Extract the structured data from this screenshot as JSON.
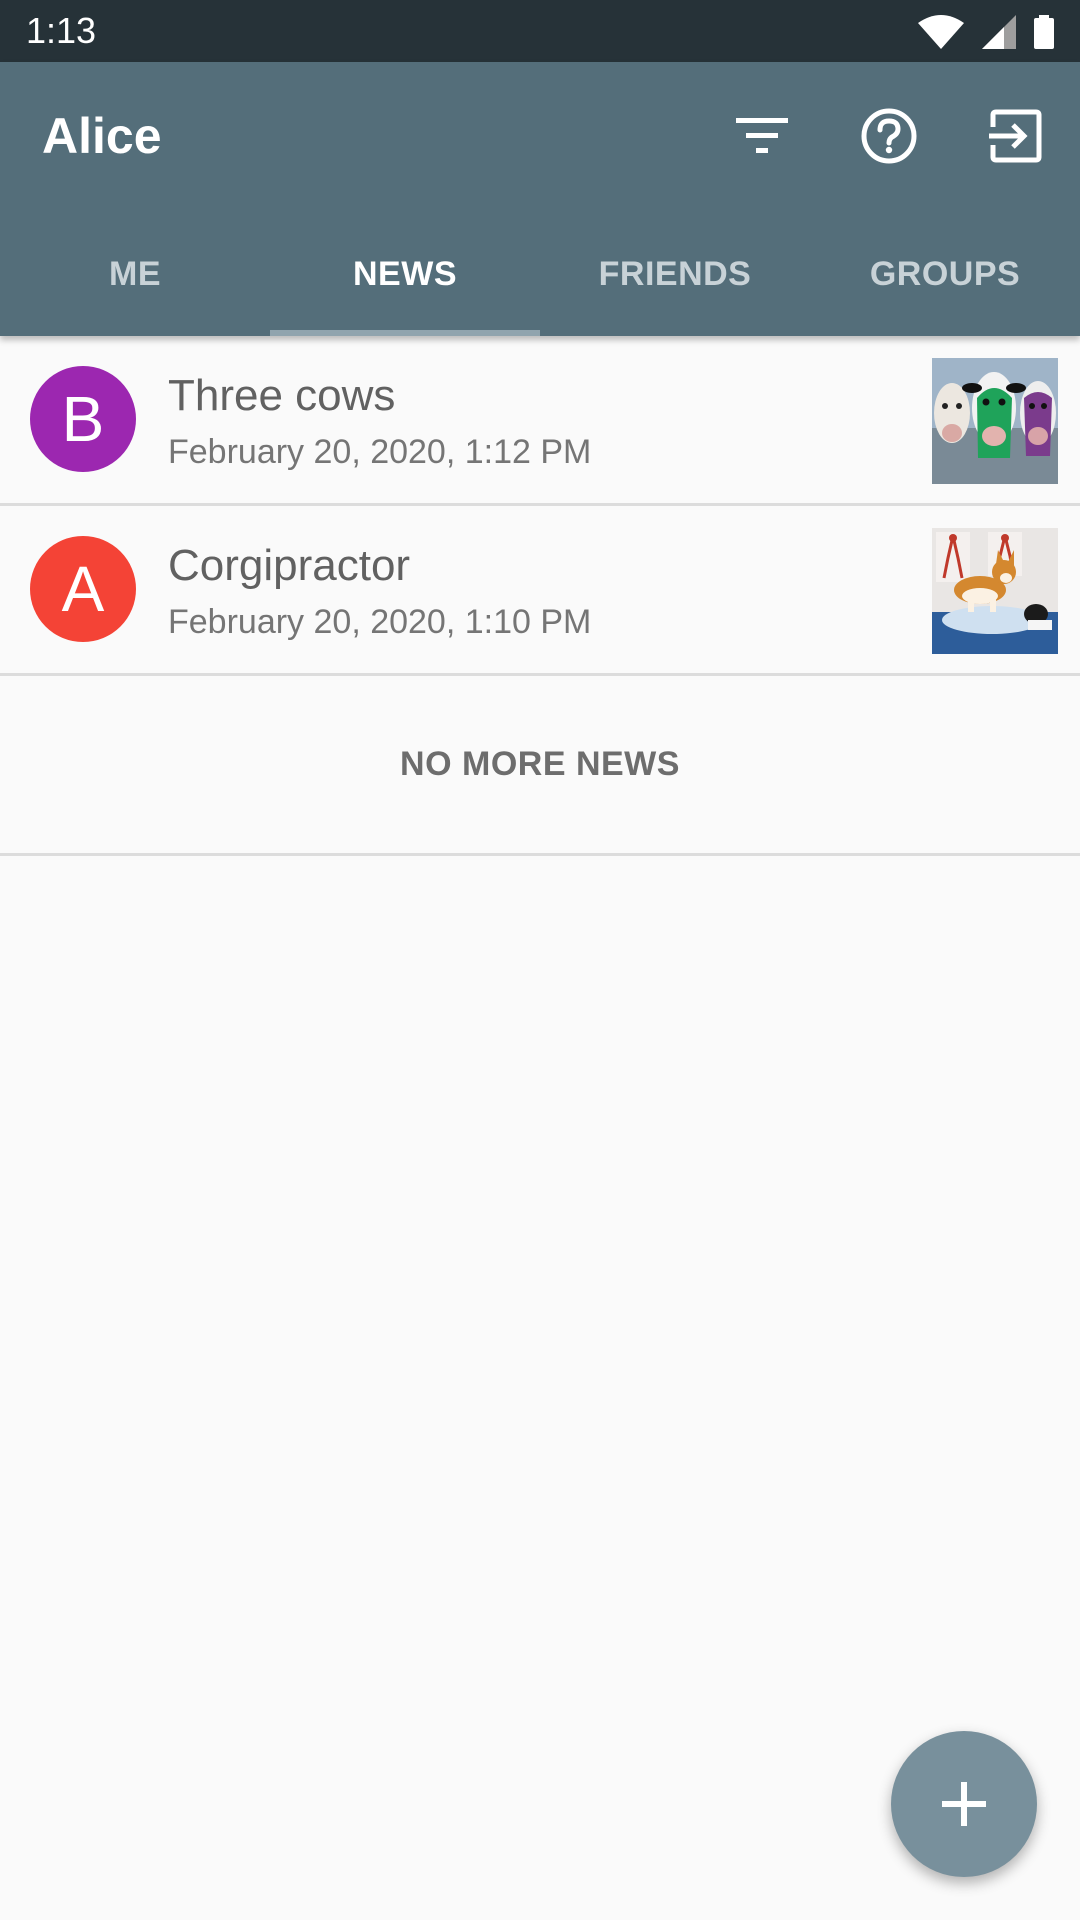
{
  "status_bar": {
    "time": "1:13",
    "icons": [
      "wifi-icon",
      "cell-signal-icon",
      "battery-icon"
    ]
  },
  "app_bar": {
    "title": "Alice",
    "actions": [
      {
        "name": "filter-icon",
        "label": "Filter"
      },
      {
        "name": "help-icon",
        "label": "Help"
      },
      {
        "name": "logout-icon",
        "label": "Log out"
      }
    ],
    "background_color": "#546e7a"
  },
  "tabs": [
    {
      "label": "ME",
      "active": false
    },
    {
      "label": "NEWS",
      "active": true
    },
    {
      "label": "FRIENDS",
      "active": false
    },
    {
      "label": "GROUPS",
      "active": false
    }
  ],
  "news": [
    {
      "avatar_letter": "B",
      "avatar_color": "#9c27b0",
      "title": "Three cows",
      "date": "February 20, 2020, 1:12 PM",
      "thumbnail": "cows-painting"
    },
    {
      "avatar_letter": "A",
      "avatar_color": "#f44336",
      "title": "Corgipractor",
      "date": "February 20, 2020, 1:10 PM",
      "thumbnail": "corgi-chiropractor-photo"
    }
  ],
  "end_message": "NO MORE NEWS",
  "fab": {
    "icon": "plus-icon",
    "color": "#78909c"
  }
}
